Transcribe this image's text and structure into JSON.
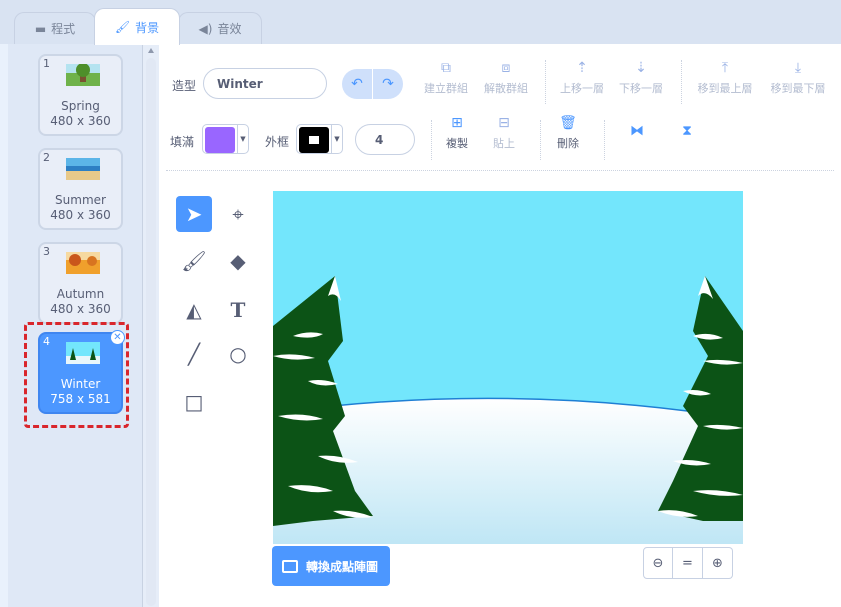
{
  "tabs": [
    {
      "label": "程式",
      "icon": "code-icon"
    },
    {
      "label": "背景",
      "icon": "paint-brush-icon"
    },
    {
      "label": "音效",
      "icon": "speaker-icon"
    }
  ],
  "costumes": [
    {
      "number": "1",
      "name": "Spring",
      "size": "480 x 360",
      "thumb": "spring-thumbnail"
    },
    {
      "number": "2",
      "name": "Summer",
      "size": "480 x 360",
      "thumb": "summer-thumbnail"
    },
    {
      "number": "3",
      "name": "Autumn",
      "size": "480 x 360",
      "thumb": "autumn-thumbnail"
    },
    {
      "number": "4",
      "name": "Winter",
      "size": "758 x 581",
      "thumb": "winter-thumbnail",
      "selected": true
    }
  ],
  "editor": {
    "costume_label": "造型",
    "costume_name": "Winter",
    "fill_label": "填滿",
    "fill_color": "#9966ff",
    "outline_label": "外框",
    "outline_color": "#000000",
    "outline_width": "4",
    "group": "建立群組",
    "ungroup": "解散群組",
    "forward": "上移一層",
    "backward": "下移一層",
    "front": "移到最上層",
    "back": "移到最下層",
    "copy": "複製",
    "paste": "貼上",
    "delete": "刪除",
    "convert": "轉換成點陣圖",
    "zoom_reset": "="
  },
  "colors": {
    "accent": "#4c97ff",
    "highlight": "#d9262c",
    "sky": "#73e6fc",
    "tree": "#0c5316"
  }
}
